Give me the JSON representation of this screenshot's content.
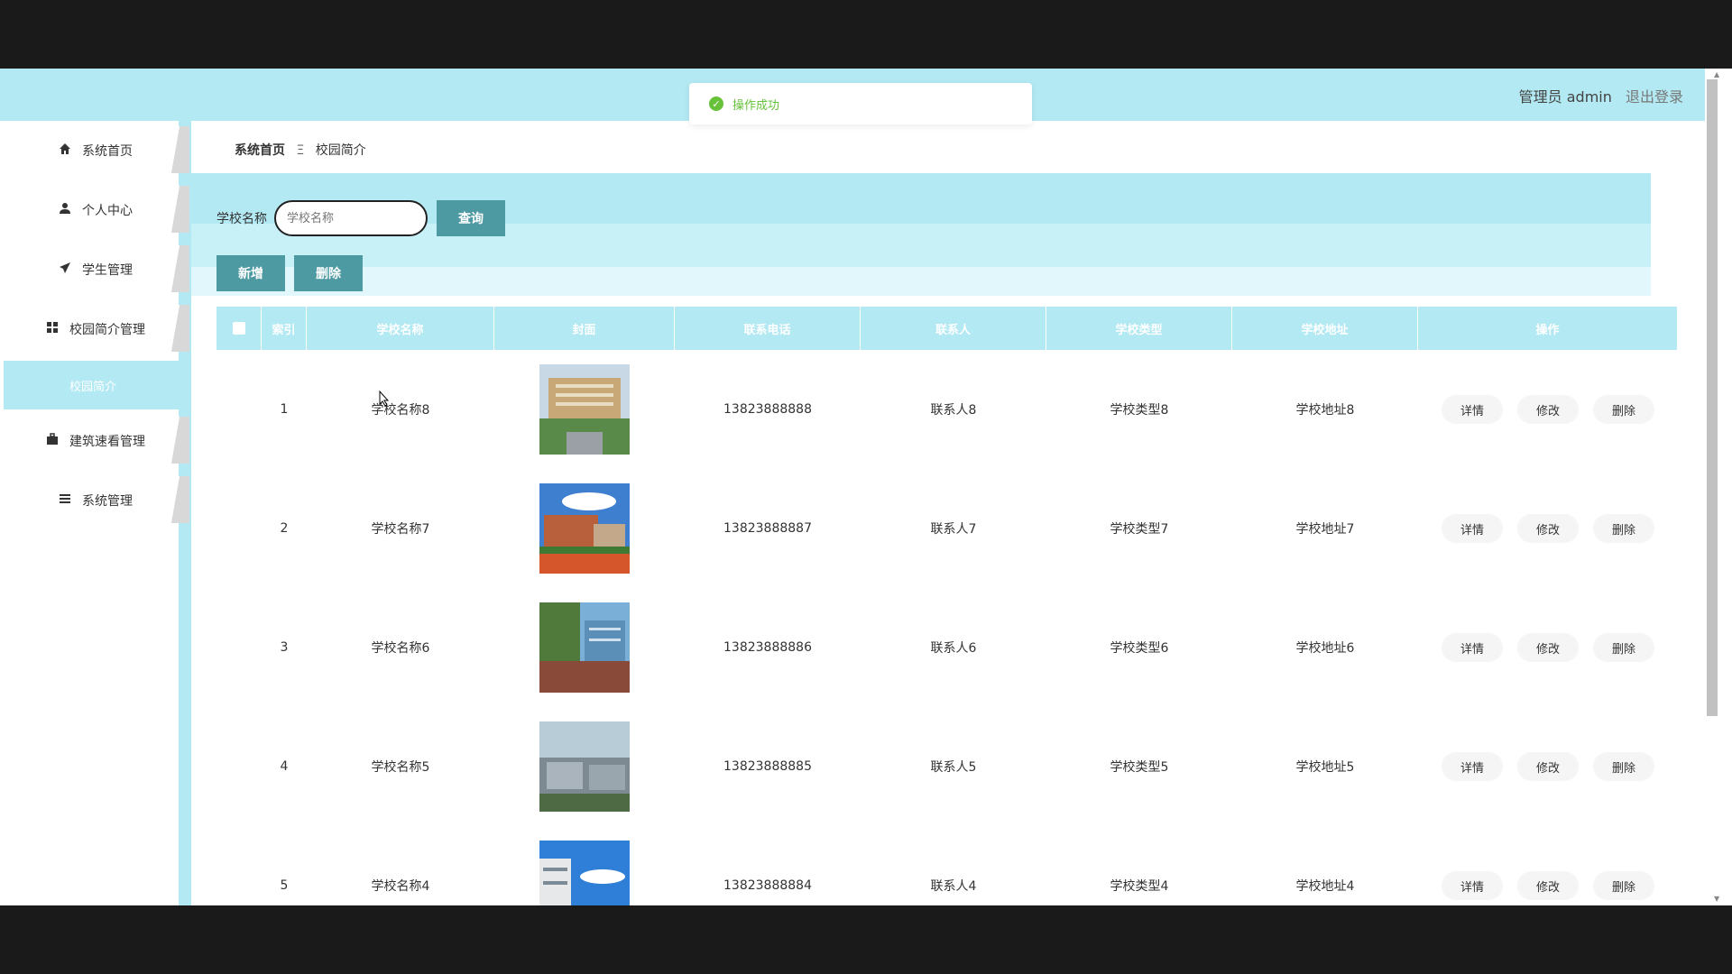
{
  "header": {
    "user_label": "管理员 admin",
    "logout": "退出登录"
  },
  "toast": {
    "message": "操作成功"
  },
  "sidebar": {
    "items": [
      {
        "label": "系统首页",
        "icon": "home-icon"
      },
      {
        "label": "个人中心",
        "icon": "user-icon"
      },
      {
        "label": "学生管理",
        "icon": "paper-plane-icon"
      },
      {
        "label": "校园简介管理",
        "icon": "grid-icon"
      }
    ],
    "sub_active": "校园简介",
    "items_after": [
      {
        "label": "建筑速看管理",
        "icon": "briefcase-icon"
      },
      {
        "label": "系统管理",
        "icon": "list-icon"
      }
    ]
  },
  "breadcrumb": {
    "home": "系统首页",
    "separator": "Ξ",
    "current": "校园简介"
  },
  "search": {
    "label": "学校名称",
    "placeholder": "学校名称",
    "button": "查询"
  },
  "actions": {
    "add": "新增",
    "delete": "删除"
  },
  "table": {
    "headers": [
      "索引",
      "学校名称",
      "封面",
      "联系电话",
      "联系人",
      "学校类型",
      "学校地址",
      "操作"
    ],
    "rows": [
      {
        "index": "1",
        "name": "学校名称8",
        "phone": "13823888888",
        "contact": "联系人8",
        "type": "学校类型8",
        "address": "学校地址8"
      },
      {
        "index": "2",
        "name": "学校名称7",
        "phone": "13823888887",
        "contact": "联系人7",
        "type": "学校类型7",
        "address": "学校地址7"
      },
      {
        "index": "3",
        "name": "学校名称6",
        "phone": "13823888886",
        "contact": "联系人6",
        "type": "学校类型6",
        "address": "学校地址6"
      },
      {
        "index": "4",
        "name": "学校名称5",
        "phone": "13823888885",
        "contact": "联系人5",
        "type": "学校类型5",
        "address": "学校地址5"
      },
      {
        "index": "5",
        "name": "学校名称4",
        "phone": "13823888884",
        "contact": "联系人4",
        "type": "学校类型4",
        "address": "学校地址4"
      }
    ],
    "ops": {
      "detail": "详情",
      "edit": "修改",
      "delete": "删除"
    }
  },
  "colors": {
    "accent": "#b3e9f3",
    "button": "#4e9aa3",
    "success": "#67c23a"
  }
}
